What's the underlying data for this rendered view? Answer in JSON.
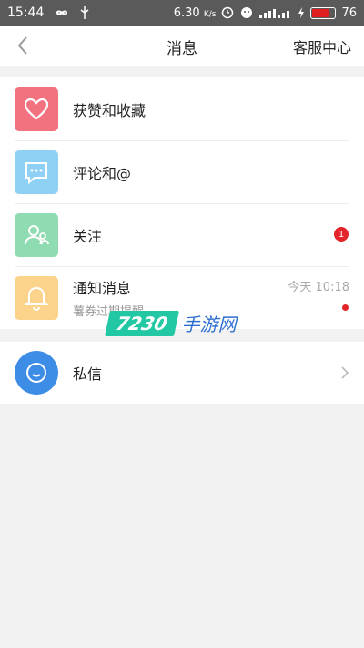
{
  "status_bar": {
    "time": "15:44",
    "speed": "6.30",
    "speed_unit": "K/s",
    "battery": "76",
    "battery_level": 0.76
  },
  "header": {
    "title": "消息",
    "right_action": "客服中心",
    "back_icon": "chevron-left-icon"
  },
  "items": [
    {
      "label": "获赞和收藏",
      "icon": "heart-icon",
      "color": "#f2727f"
    },
    {
      "label": "评论和@",
      "icon": "comment-icon",
      "color": "#8fd0f5"
    },
    {
      "label": "关注",
      "icon": "users-icon",
      "color": "#8fdcb2",
      "badge": "1"
    },
    {
      "label": "通知消息",
      "sub": "薯券过期提醒",
      "icon": "bell-icon",
      "color": "#fbd38b",
      "time": "今天  10:18"
    }
  ],
  "direct_message": {
    "label": "私信",
    "icon": "smile-chat-icon",
    "color": "#3d8de6"
  },
  "watermark": {
    "number": "7230",
    "text": "手游网"
  }
}
